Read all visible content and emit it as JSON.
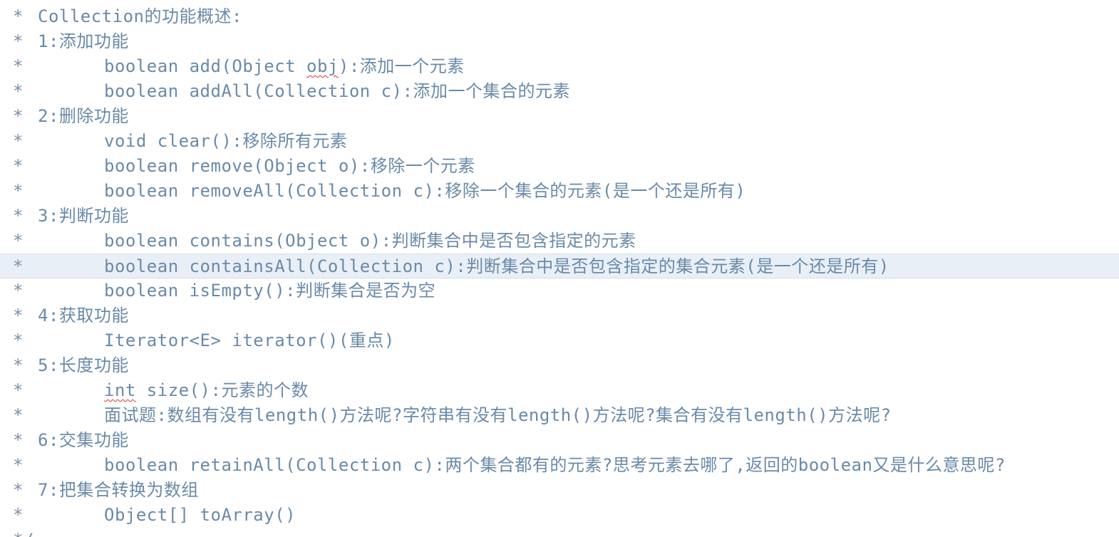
{
  "lines": [
    {
      "star": "*",
      "text": "Collection的功能概述:"
    },
    {
      "star": "*",
      "text": "1:添加功能"
    },
    {
      "star": "*",
      "text_pre": "boolean add(Object ",
      "text_squiggle": "obj",
      "text_post": "):添加一个元素"
    },
    {
      "star": "*",
      "text": "boolean addAll(Collection c):添加一个集合的元素"
    },
    {
      "star": "*",
      "text": "2:删除功能"
    },
    {
      "star": "*",
      "text": "void clear():移除所有元素"
    },
    {
      "star": "*",
      "text": "boolean remove(Object o):移除一个元素"
    },
    {
      "star": "*",
      "text": "boolean removeAll(Collection c):移除一个集合的元素(是一个还是所有)"
    },
    {
      "star": "*",
      "text": "3:判断功能"
    },
    {
      "star": "*",
      "text": "boolean contains(Object o):判断集合中是否包含指定的元素"
    },
    {
      "star": "*",
      "text": "boolean containsAll(Collection c):判断集合中是否包含指定的集合元素(是一个还是所有)"
    },
    {
      "star": "*",
      "text": "boolean isEmpty():判断集合是否为空"
    },
    {
      "star": "*",
      "text": "4:获取功能"
    },
    {
      "star": "*",
      "text": "Iterator<E> iterator()(重点)"
    },
    {
      "star": "*",
      "text": "5:长度功能"
    },
    {
      "star": "*",
      "text_squiggle": "int",
      "text_post": " size():元素的个数"
    },
    {
      "star": "*",
      "text": "面试题:数组有没有length()方法呢?字符串有没有length()方法呢?集合有没有length()方法呢?"
    },
    {
      "star": "*",
      "text": "6:交集功能"
    },
    {
      "star": "*",
      "text": "boolean retainAll(Collection c):两个集合都有的元素?思考元素去哪了,返回的boolean又是什么意思呢?"
    },
    {
      "star": "*",
      "text": "7:把集合转换为数组"
    },
    {
      "star": "*",
      "text": "Object[] toArray()"
    },
    {
      "star": "*/",
      "text": ""
    }
  ]
}
